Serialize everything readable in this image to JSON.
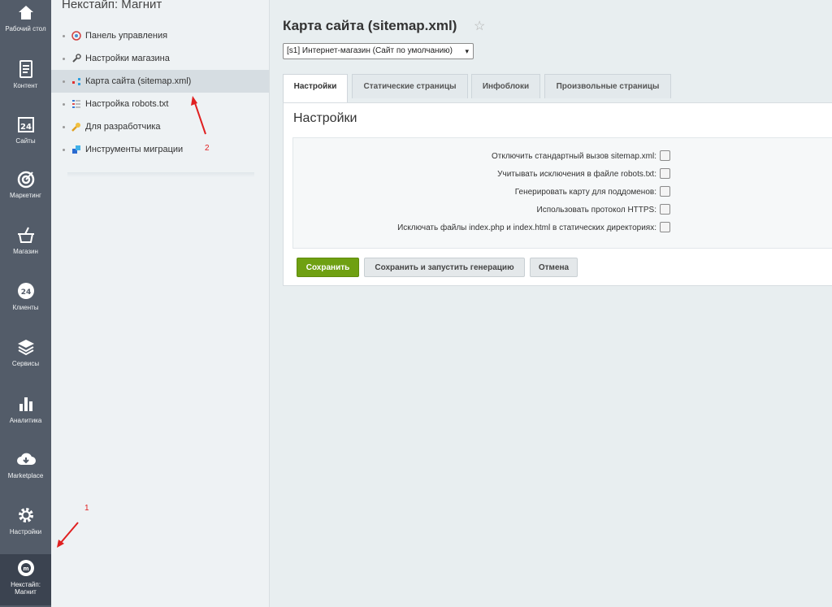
{
  "left_nav": [
    {
      "label": "Рабочий стол",
      "icon": "home-icon"
    },
    {
      "label": "Контент",
      "icon": "content-icon"
    },
    {
      "label": "Сайты",
      "icon": "calendar-24-icon"
    },
    {
      "label": "Маркетинг",
      "icon": "target-icon"
    },
    {
      "label": "Магазин",
      "icon": "basket-icon"
    },
    {
      "label": "Клиенты",
      "icon": "crm-24-icon"
    },
    {
      "label": "Сервисы",
      "icon": "layers-icon"
    },
    {
      "label": "Аналитика",
      "icon": "bar-chart-icon"
    },
    {
      "label": "Marketplace",
      "icon": "cloud-download-icon"
    },
    {
      "label": "Настройки",
      "icon": "gear-icon"
    },
    {
      "label": "Некстайп: Магнит",
      "icon": "magnit-logo-icon"
    }
  ],
  "sidebar": {
    "title": "Некстайп: Магнит",
    "items": [
      {
        "label": "Панель управления",
        "icon": "control-panel-icon"
      },
      {
        "label": "Настройки магазина",
        "icon": "wrench-icon"
      },
      {
        "label": "Карта сайта (sitemap.xml)",
        "icon": "sitemap-icon"
      },
      {
        "label": "Настройка robots.txt",
        "icon": "list-icon"
      },
      {
        "label": "Для разработчика",
        "icon": "developer-icon"
      },
      {
        "label": "Инструменты миграции",
        "icon": "migration-icon"
      }
    ]
  },
  "main": {
    "title": "Карта сайта (sitemap.xml)",
    "site_select": "[s1] Интернет-магазин (Сайт по умолчанию)",
    "tabs": [
      "Настройки",
      "Статические страницы",
      "Инфоблоки",
      "Произвольные страницы"
    ],
    "panel_title": "Настройки",
    "fields": [
      {
        "label": "Отключить стандартный вызов sitemap.xml:"
      },
      {
        "label": "Учитывать исключения в файле robots.txt:"
      },
      {
        "label": "Генерировать карту для поддоменов:"
      },
      {
        "label": "Использовать протокол HTTPS:"
      },
      {
        "label": "Исключать файлы index.php и index.html в статических директориях:"
      }
    ],
    "buttons": {
      "save": "Сохранить",
      "save_generate": "Сохранить и запустить генерацию",
      "cancel": "Отмена"
    }
  },
  "annotations": [
    "1",
    "2"
  ],
  "colors": {
    "nav_bg": "#535c69",
    "save_green": "#6fa012",
    "arrow_red": "#e02020"
  }
}
